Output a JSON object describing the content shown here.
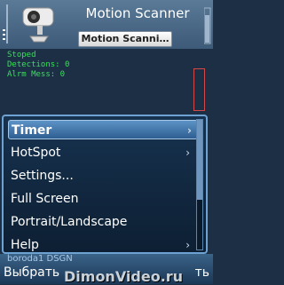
{
  "header": {
    "title": "Motion Scanner",
    "document_label": "Motion Scanni…"
  },
  "status": {
    "line1": "Stoped",
    "line2": "Detections: 0",
    "line3": "Alrm Mess: 0"
  },
  "menu": {
    "items": [
      {
        "label": "Timer",
        "has_submenu": true,
        "selected": true
      },
      {
        "label": "HotSpot",
        "has_submenu": true,
        "selected": false
      },
      {
        "label": "Settings...",
        "has_submenu": false,
        "selected": false
      },
      {
        "label": "Full Screen",
        "has_submenu": false,
        "selected": false
      },
      {
        "label": "Portrait/Landscape",
        "has_submenu": false,
        "selected": false
      },
      {
        "label": "Help",
        "has_submenu": true,
        "selected": false
      }
    ]
  },
  "footer": {
    "brand": "boroda1 DSGN",
    "left_softkey": "Выбрать",
    "right_softkey": "ть",
    "watermark": "DimonVideo.ru"
  },
  "icons": {
    "app": "camera-icon",
    "signal": "signal-strength-icon",
    "battery": "battery-icon",
    "submenu": "chevron-right-icon"
  }
}
